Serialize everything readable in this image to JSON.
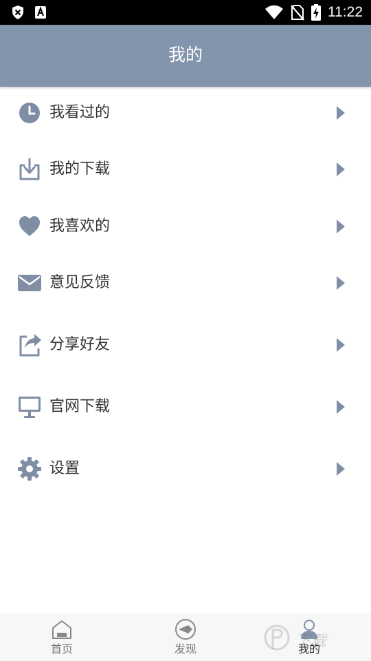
{
  "status_bar": {
    "time": "11:22",
    "left_icons": [
      "shield-x-icon",
      "letter-a-icon"
    ],
    "right_icons": [
      "wifi-icon",
      "no-sim-icon",
      "battery-charging-icon"
    ]
  },
  "header": {
    "title": "我的"
  },
  "menu": {
    "items": [
      {
        "label": "我看过的",
        "icon": "clock-icon"
      },
      {
        "label": "我的下载",
        "icon": "download-icon"
      },
      {
        "label": "我喜欢的",
        "icon": "heart-icon"
      },
      {
        "label": "意见反馈",
        "icon": "mail-icon"
      },
      {
        "label": "分享好友",
        "icon": "share-icon"
      },
      {
        "label": "官网下载",
        "icon": "monitor-icon"
      },
      {
        "label": "设置",
        "icon": "gear-icon"
      }
    ]
  },
  "tabs": [
    {
      "label": "首页",
      "icon": "home-icon"
    },
    {
      "label": "发现",
      "icon": "discover-icon"
    },
    {
      "label": "我的",
      "icon": "user-icon",
      "active": true
    }
  ],
  "watermark": {
    "text": "下载"
  },
  "colors": {
    "accent": "#8395ad",
    "icon": "#7f8ea5",
    "text": "#333333",
    "status_bar": "#000000",
    "tab_bar": "#f7f7f7"
  }
}
